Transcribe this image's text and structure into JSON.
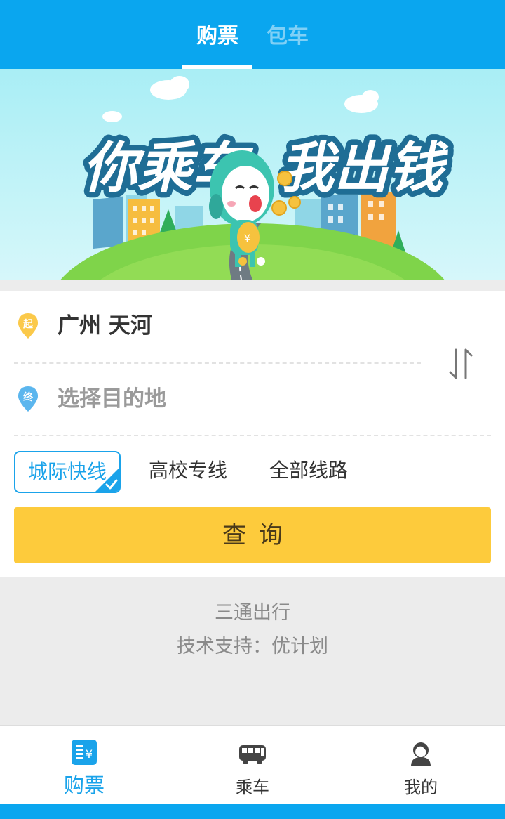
{
  "header": {
    "tabs": [
      {
        "label": "购票",
        "active": true
      },
      {
        "label": "包车",
        "active": false
      }
    ]
  },
  "banner": {
    "slogan_left": "你乘车",
    "slogan_right": "我出钱"
  },
  "search": {
    "from_badge": "起",
    "from_value": "广州 天河",
    "to_badge": "终",
    "to_placeholder": "选择目的地",
    "swap_icon": "swap-arrows-icon"
  },
  "route_types": [
    {
      "label": "城际快线",
      "selected": true
    },
    {
      "label": "高校专线",
      "selected": false
    },
    {
      "label": "全部线路",
      "selected": false
    }
  ],
  "query_button": "查询",
  "footer": {
    "line1": "三通出行",
    "line2": "技术支持：优计划"
  },
  "tabbar": {
    "items": [
      {
        "label": "购票",
        "icon": "ticket-icon",
        "active": true
      },
      {
        "label": "乘车",
        "icon": "bus-icon",
        "active": false
      },
      {
        "label": "我的",
        "icon": "user-icon",
        "active": false
      }
    ]
  },
  "colors": {
    "primary": "#0aa6ef",
    "accent_blue": "#1aa3ea",
    "button_yellow": "#fdcb3c",
    "from_pin": "#fbc94a",
    "to_pin": "#5bb6ee"
  }
}
